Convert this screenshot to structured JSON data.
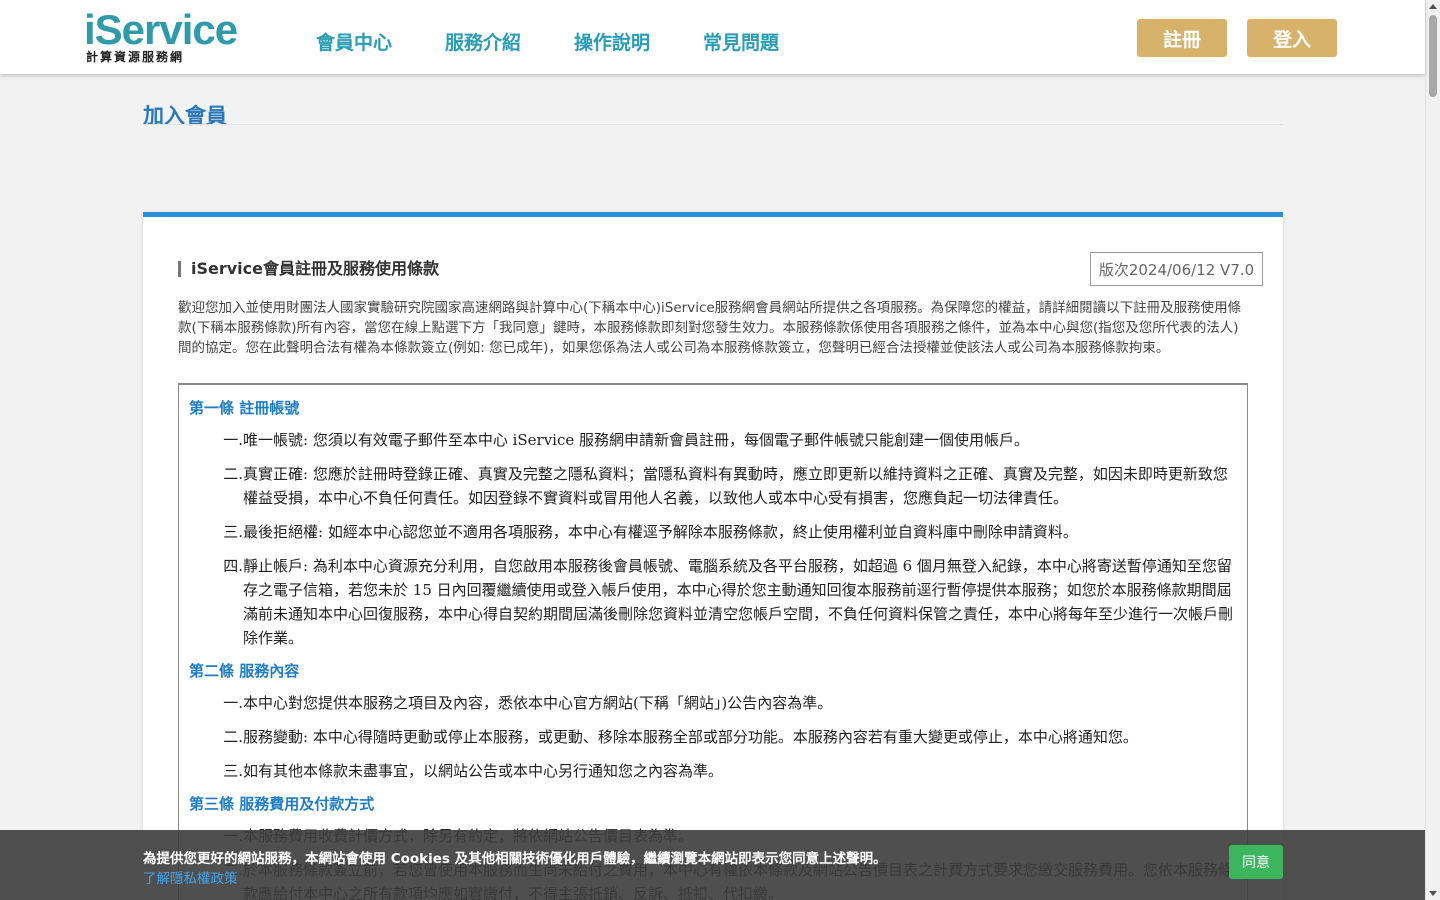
{
  "header": {
    "logo_main": "iService",
    "logo_sub": "計算資源服務網",
    "nav": [
      "會員中心",
      "服務介紹",
      "操作說明",
      "常見問題"
    ],
    "register_label": "註冊",
    "login_label": "登入"
  },
  "page": {
    "title": "加入會員"
  },
  "terms": {
    "title": "iService會員註冊及服務使用條款",
    "version": "版次2024/06/12 V7.0",
    "intro": "歡迎您加入並使用財團法人國家實驗研究院國家高速網路與計算中心(下稱本中心)iService服務網會員網站所提供之各項服務。為保障您的權益，請詳細閱讀以下註冊及服務使用條款(下稱本服務條款)所有內容，當您在線上點選下方「我同意」鍵時，本服務條款即刻對您發生效力。本服務條款係使用各項服務之條件，並為本中心與您(指您及您所代表的法人)間的協定。您在此聲明合法有權為本條款簽立(例如: 您已成年)，如果您係為法人或公司為本服務條款簽立，您聲明已經合法授權並使該法人或公司為本服務條款拘束。",
    "articles": [
      {
        "heading": "第一條 註冊帳號",
        "clauses": [
          {
            "num": "一.",
            "text": "唯一帳號: 您須以有效電子郵件至本中心 iService 服務網申請新會員註冊，每個電子郵件帳號只能創建一個使用帳戶。"
          },
          {
            "num": "二.",
            "text": "真實正確: 您應於註冊時登錄正確、真實及完整之隱私資料；當隱私資料有異動時，應立即更新以維持資料之正確、真實及完整，如因未即時更新致您權益受損，本中心不負任何責任。如因登錄不實資料或冒用他人名義，以致他人或本中心受有損害，您應負起一切法律責任。"
          },
          {
            "num": "三.",
            "text": "最後拒絕權: 如經本中心認您並不適用各項服務，本中心有權逕予解除本服務條款，終止使用權利並自資料庫中刪除申請資料。"
          },
          {
            "num": "四.",
            "text": "靜止帳戶: 為利本中心資源充分利用，自您啟用本服務後會員帳號、電腦系統及各平台服務，如超過 6 個月無登入紀錄，本中心將寄送暫停通知至您留存之電子信箱，若您未於 15 日內回覆繼續使用或登入帳戶使用，本中心得於您主動通知回復本服務前逕行暫停提供本服務；如您於本服務條款期間屆滿前未通知本中心回復服務，本中心得自契約期間屆滿後刪除您資料並清空您帳戶空間，不負任何資料保管之責任，本中心將每年至少進行一次帳戶刪除作業。"
          }
        ]
      },
      {
        "heading": "第二條 服務內容",
        "clauses": [
          {
            "num": "一.",
            "text": "本中心對您提供本服務之項目及內容，悉依本中心官方網站(下稱「網站」)公告內容為準。"
          },
          {
            "num": "二.",
            "text": "服務變動: 本中心得隨時更動或停止本服務，或更動、移除本服務全部或部分功能。本服務內容若有重大變更或停止，本中心將通知您。"
          },
          {
            "num": "三.",
            "text": "如有其他本條款未盡事宜，以網站公告或本中心另行通知您之內容為準。"
          }
        ]
      },
      {
        "heading": "第三條 服務費用及付款方式",
        "clauses": [
          {
            "num": "一.",
            "text": "本服務費用收費計價方式，除另有約定，將依網站公告價目表為準。"
          },
          {
            "num": "二.",
            "text": "於本服務條款簽立前，若您曾使用本服務而生尚未給付之費用，本中心有權依本條款及網站公告價目表之計費方式要求您繳交服務費用。您依本服務條款應給付本中心之所有款項均應如實繳付，不得主張抵銷、反訴、抵扣、代扣繳。"
          }
        ]
      }
    ]
  },
  "cookie": {
    "text": "為提供您更好的網站服務，本網站會使用 Cookies 及其他相關技術優化用戶體驗，繼續瀏覽本網站即表示您同意上述聲明。",
    "link": "了解隱私權政策",
    "agree": "同意"
  }
}
